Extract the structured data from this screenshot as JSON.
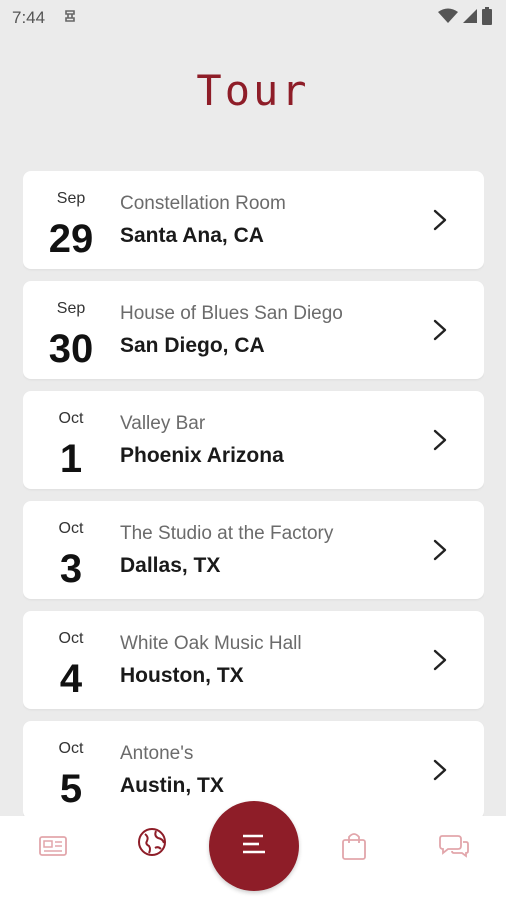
{
  "status_bar": {
    "time": "7:44"
  },
  "page": {
    "title": "Tour"
  },
  "colors": {
    "accent": "#8e1d28",
    "nav_inactive": "#e2a6ab",
    "background": "#ebebeb"
  },
  "tour_dates": [
    {
      "month": "Sep",
      "day": "29",
      "venue": "Constellation Room",
      "city": "Santa Ana, CA"
    },
    {
      "month": "Sep",
      "day": "30",
      "venue": "House of Blues San Diego",
      "city": "San Diego, CA"
    },
    {
      "month": "Oct",
      "day": "1",
      "venue": "Valley Bar",
      "city": "Phoenix Arizona"
    },
    {
      "month": "Oct",
      "day": "3",
      "venue": "The Studio at the Factory",
      "city": "Dallas, TX"
    },
    {
      "month": "Oct",
      "day": "4",
      "venue": "White Oak Music Hall",
      "city": "Houston, TX"
    },
    {
      "month": "Oct",
      "day": "5",
      "venue": "Antone's",
      "city": "Austin, TX"
    }
  ],
  "bottom_nav": {
    "items": [
      {
        "icon": "news-icon",
        "active": false
      },
      {
        "icon": "globe-icon",
        "active": true
      },
      {
        "icon": "menu-icon",
        "active": true
      },
      {
        "icon": "shopping-bag-icon",
        "active": false
      },
      {
        "icon": "chat-icon",
        "active": false
      }
    ]
  }
}
